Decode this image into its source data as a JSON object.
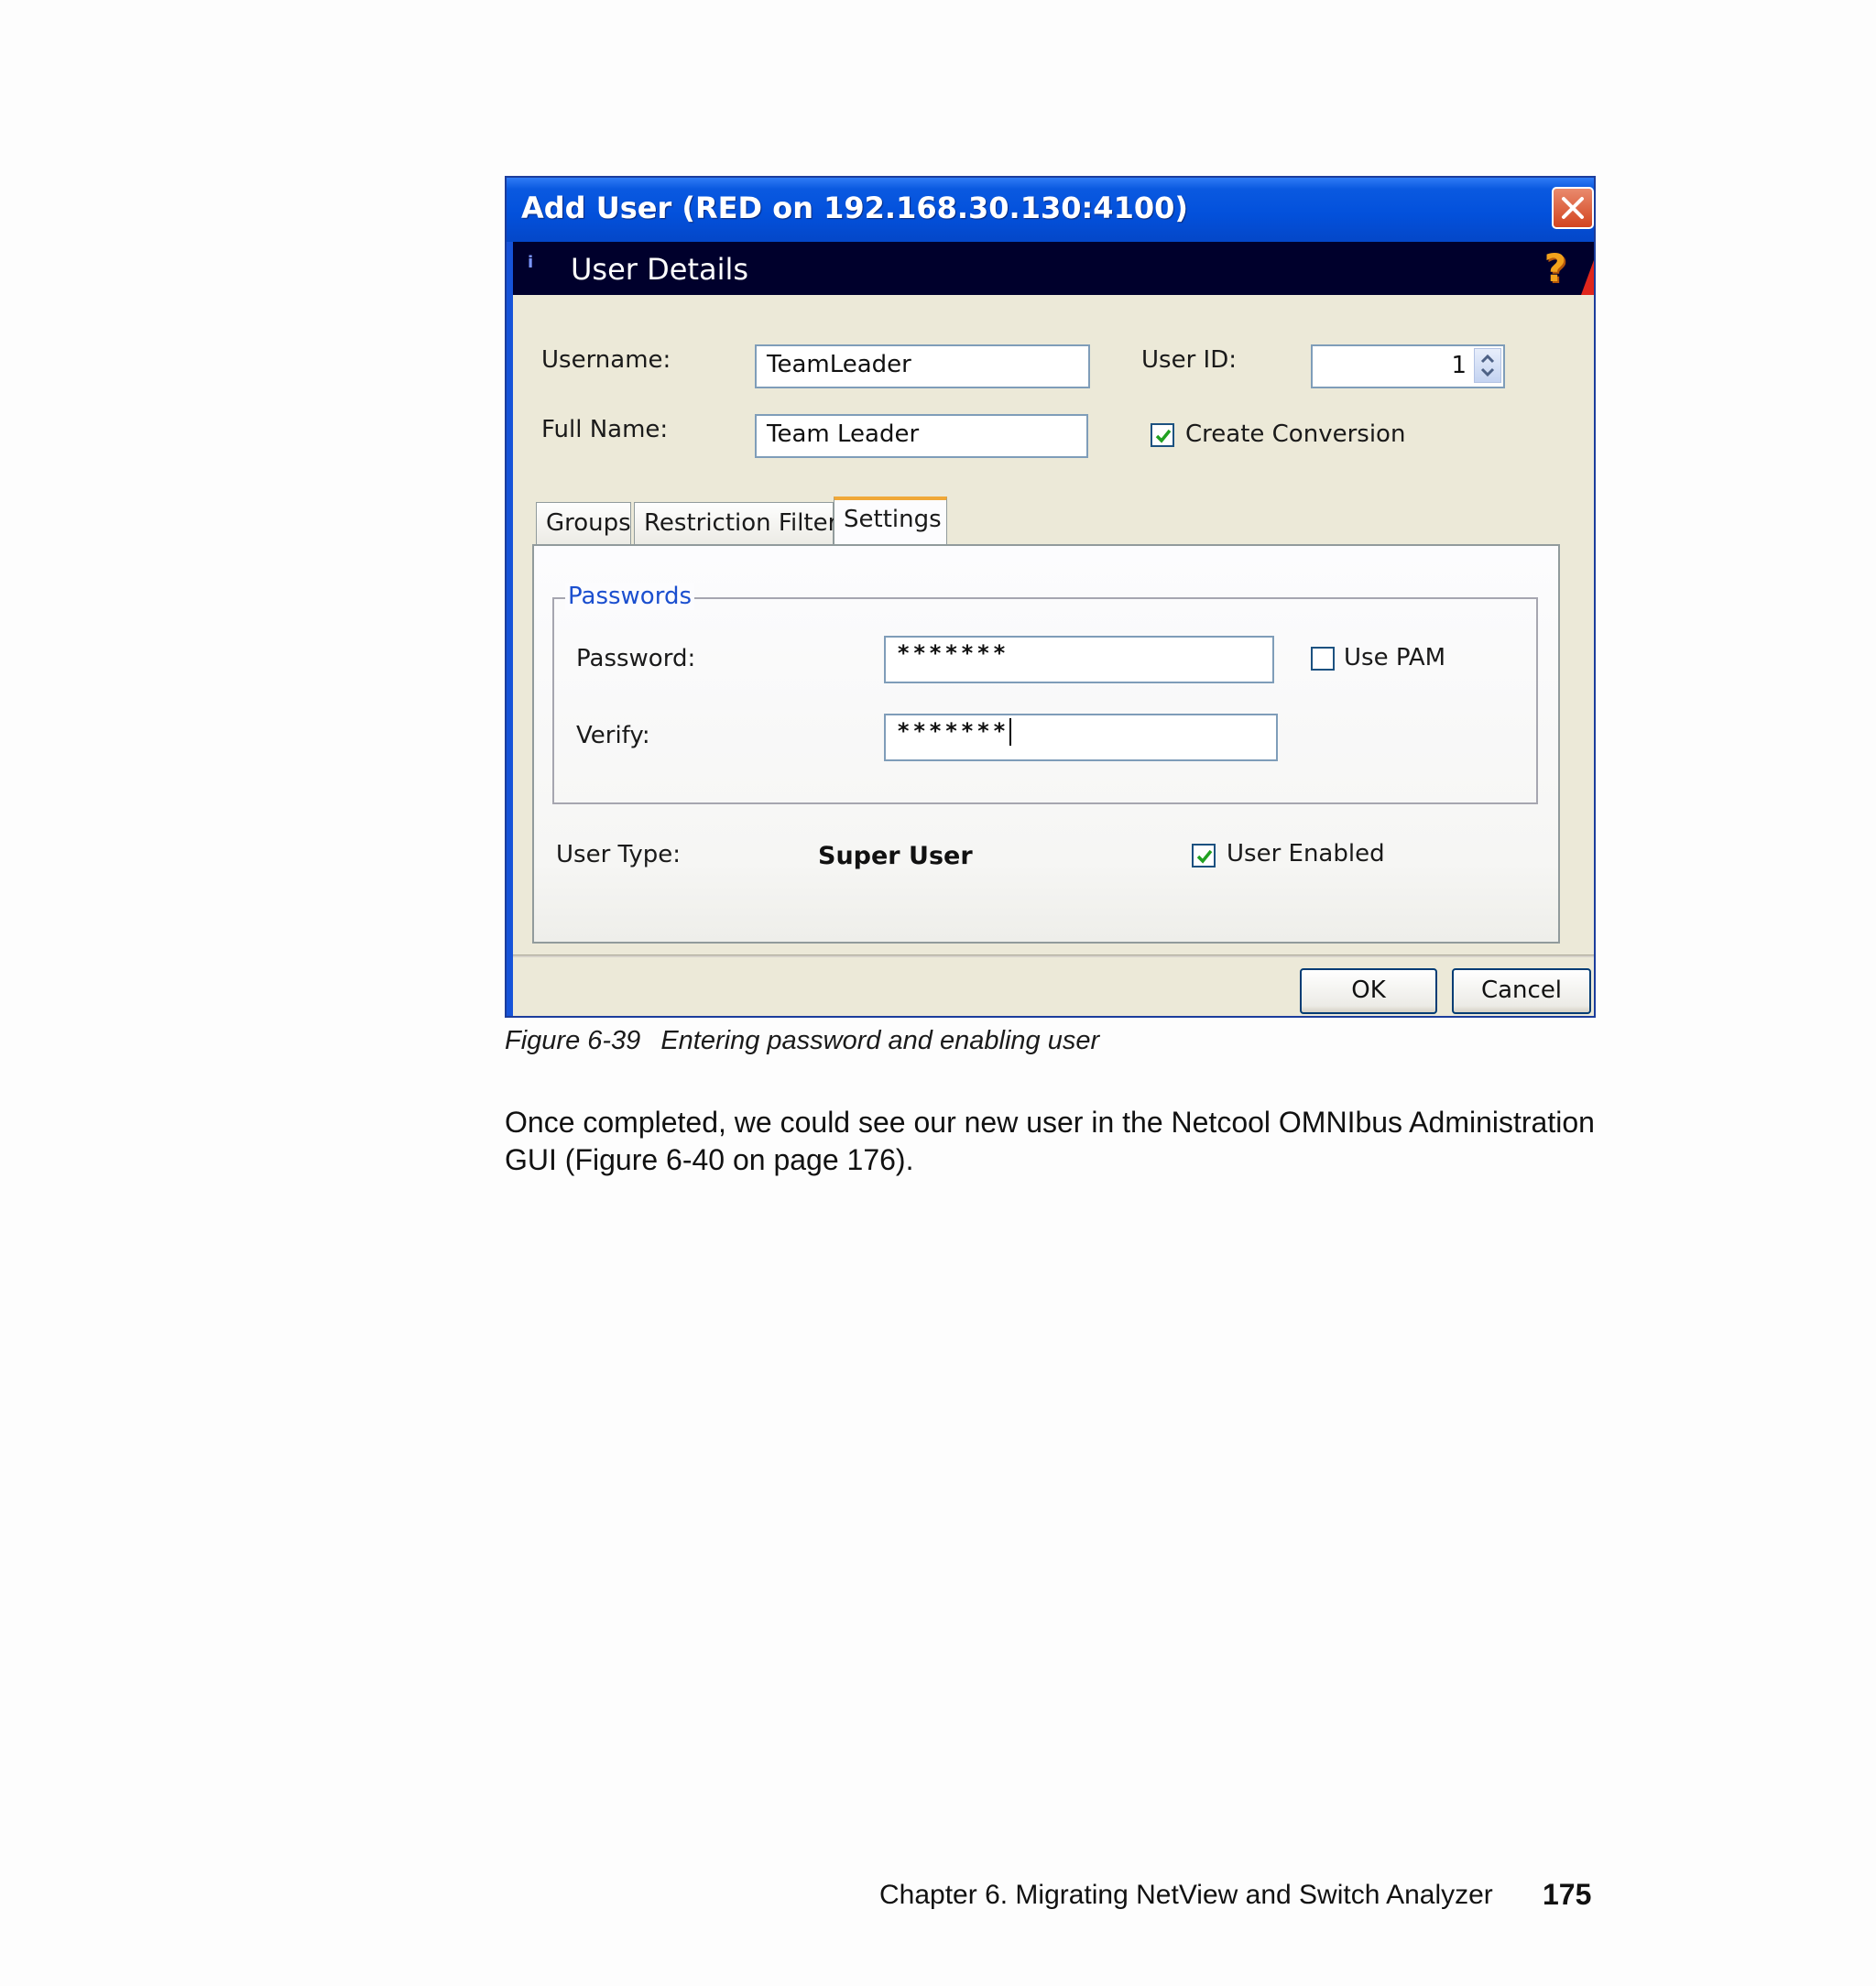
{
  "window": {
    "title": "Add User (RED on 192.168.30.130:4100)",
    "banner_title": "User Details",
    "help_icon": "?",
    "info_mark": "i"
  },
  "form": {
    "username_label": "Username:",
    "username_value": "TeamLeader",
    "fullname_label": "Full Name:",
    "fullname_value": "Team Leader",
    "userid_label": "User ID:",
    "userid_value": "1",
    "create_conversion_label": "Create Conversion",
    "create_conversion_checked": true
  },
  "tabs": [
    {
      "label": "Groups",
      "active": false
    },
    {
      "label": "Restriction Filters",
      "active": false
    },
    {
      "label": "Settings",
      "active": true
    }
  ],
  "settings": {
    "passwords_legend": "Passwords",
    "password_label": "Password:",
    "password_value": "*******",
    "verify_label": "Verify:",
    "verify_value": "*******",
    "use_pam_label": "Use PAM",
    "use_pam_checked": false,
    "user_type_label": "User Type:",
    "user_type_value": "Super User",
    "user_enabled_label": "User Enabled",
    "user_enabled_checked": true
  },
  "buttons": {
    "ok": "OK",
    "cancel": "Cancel"
  },
  "document": {
    "figure_number": "Figure 6-39",
    "figure_caption": "Entering password and enabling user",
    "paragraph": "Once completed, we could see our new user in the Netcool OMNIbus Administration GUI (Figure 6-40 on page 176).",
    "footer_chapter": "Chapter 6. Migrating NetView and Switch Analyzer",
    "page_number": "175"
  },
  "colors": {
    "titlebar": "#0351dc",
    "banner": "#00002c",
    "dialog_bg": "#ece9d8",
    "legend_blue": "#1b4fcf",
    "tab_highlight": "#f0a838",
    "check_green": "#21a121"
  }
}
